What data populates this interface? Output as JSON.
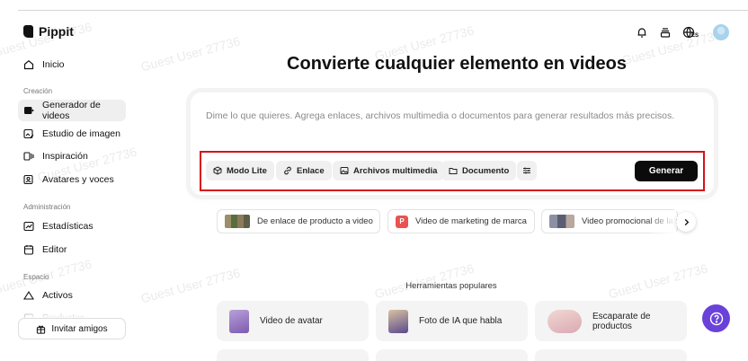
{
  "app": {
    "name": "Pippit"
  },
  "watermark": "Guest User 27736",
  "sidebar": {
    "items_top": [
      {
        "label": "Inicio",
        "icon": "home-icon"
      }
    ],
    "sections": [
      {
        "title": "Creación",
        "items": [
          {
            "label": "Generador de videos",
            "icon": "video-plus-icon",
            "active": true
          },
          {
            "label": "Estudio de imagen",
            "icon": "image-edit-icon"
          },
          {
            "label": "Inspiración",
            "icon": "film-icon"
          },
          {
            "label": "Avatares y voces",
            "icon": "avatar-icon"
          }
        ]
      },
      {
        "title": "Administración",
        "items": [
          {
            "label": "Estadísticas",
            "icon": "chart-icon"
          },
          {
            "label": "Editor",
            "icon": "calendar-icon"
          }
        ]
      },
      {
        "title": "Espacio",
        "items": [
          {
            "label": "Activos",
            "icon": "cloud-icon"
          },
          {
            "label": "Productos",
            "icon": "product-icon"
          }
        ]
      }
    ],
    "invite_label": "Invitar amigos"
  },
  "header_icons": [
    "bell-icon",
    "inbox-icon",
    "globe-language-icon",
    "avatar"
  ],
  "language_badge": "ES",
  "main": {
    "title": "Convierte cualquier elemento en videos",
    "prompt_placeholder": "Dime lo que quieres. Agrega enlaces, archivos multimedia o documentos para generar resultados más precisos.",
    "tools": [
      {
        "label": "Modo Lite",
        "icon": "cube-icon"
      },
      {
        "label": "Enlace",
        "icon": "link-icon"
      },
      {
        "label": "Archivos multimedia",
        "icon": "image-icon"
      },
      {
        "label": "Documento",
        "icon": "folder-icon"
      },
      {
        "label": "",
        "icon": "settings-sliders-icon"
      }
    ],
    "generate_label": "Generar",
    "suggestions": [
      {
        "label": "De enlace de producto a video"
      },
      {
        "label": "Video de marketing de marca",
        "badge": "P"
      },
      {
        "label": "Video promocional de la marca"
      }
    ],
    "popular_title": "Herramientas populares",
    "popular_tools": [
      {
        "label": "Video de avatar"
      },
      {
        "label": "Foto de IA que habla"
      },
      {
        "label": "Escaparate de productos"
      }
    ]
  },
  "colors": {
    "accent": "#6a41d9",
    "highlight": "#d8101c",
    "button": "#0b0b0b"
  }
}
